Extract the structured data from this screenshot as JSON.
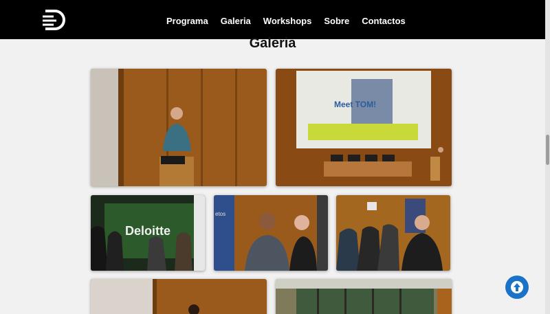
{
  "header": {
    "nav": [
      "Programa",
      "Galeria",
      "Workshops",
      "Sobre",
      "Contactos"
    ]
  },
  "page": {
    "title": "Galeria"
  },
  "gallery": {
    "slide_text": "Meet TOM!",
    "booth_sign": "Deloitte",
    "side_banner": "etos"
  },
  "colors": {
    "accent": "#1a73c9",
    "header_bg": "#000000"
  },
  "icons": {
    "scroll_top": "arrow-up-icon",
    "logo": "logo-icon"
  }
}
